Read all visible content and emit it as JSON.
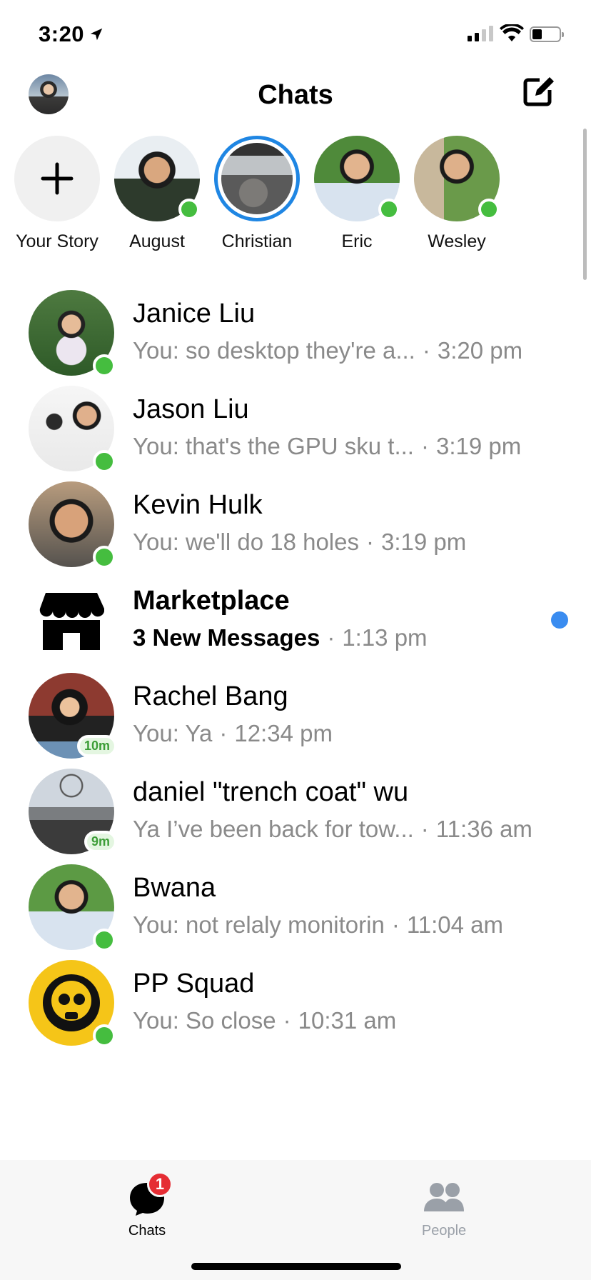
{
  "status_bar": {
    "time": "3:20"
  },
  "header": {
    "title": "Chats"
  },
  "stories": [
    {
      "name": "Your Story"
    },
    {
      "name": "August",
      "online": true
    },
    {
      "name": "Christian"
    },
    {
      "name": "Eric",
      "online": true
    },
    {
      "name": "Wesley",
      "online": true
    }
  ],
  "chats": [
    {
      "name": "Janice Liu",
      "snippet": "You: so desktop they're a...",
      "time": "3:20 pm",
      "online": true
    },
    {
      "name": "Jason Liu",
      "snippet": "You: that's the GPU sku t...",
      "time": "3:19 pm",
      "online": true
    },
    {
      "name": "Kevin Hulk",
      "snippet": "You: we'll do 18 holes",
      "time": "3:19 pm",
      "online": true
    },
    {
      "name": "Marketplace",
      "snippet": "3 New Messages",
      "time": "1:13 pm",
      "unread": true
    },
    {
      "name": "Rachel Bang",
      "snippet": "You: Ya",
      "time": "12:34 pm",
      "active_badge": "10m"
    },
    {
      "name": "daniel \"trench coat\" wu",
      "snippet": "Ya I’ve been back for tow...",
      "time": "11:36 am",
      "active_badge": "9m"
    },
    {
      "name": "Bwana",
      "snippet": "You: not relaly monitorin",
      "time": "11:04 am",
      "online": true
    },
    {
      "name": "PP Squad",
      "snippet": "You: So close",
      "time": "10:31 am",
      "online": true
    }
  ],
  "separator": "·",
  "tab_bar": {
    "chats": {
      "label": "Chats",
      "badge": "1"
    },
    "people": {
      "label": "People"
    }
  },
  "colors": {
    "online": "#45bd3f",
    "unread_dot": "#3a8cf0",
    "story_ring": "#1f86e3",
    "badge": "#e52d34"
  }
}
